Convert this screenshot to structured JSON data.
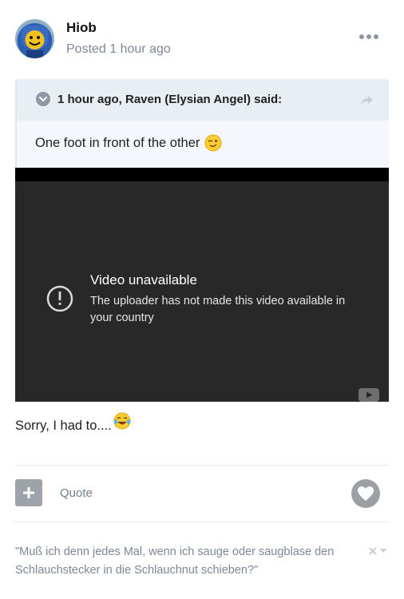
{
  "author": {
    "name": "Hiob",
    "posted": "Posted 1 hour ago",
    "avatar_icon": "lego-spaceman-avatar"
  },
  "quote": {
    "citation": "1 hour ago, Raven (Elysian Angel) said:",
    "text": "One foot in front of the other",
    "emoji": "wink-emoji"
  },
  "video": {
    "title": "Video unavailable",
    "message": "The uploader has not made this video available in your country",
    "alert_icon": "alert-circle-icon",
    "logo_icon": "youtube-icon"
  },
  "post": {
    "text": "Sorry, I had to....",
    "emoji": "tears-of-joy-emoji"
  },
  "actions": {
    "quote_label": "Quote",
    "like_icon": "heart-icon",
    "plus_icon": "plus-icon"
  },
  "signature": {
    "text": "\"Muß ich denn jedes Mal, wenn ich sauge oder saugblase den Schlauchstecker in die Schlauchnut schieben?\""
  },
  "colors": {
    "muted": "#7d8897",
    "quote_bg": "#f4f8fc",
    "quote_header_bg": "#e8eef4",
    "video_bg": "#282828"
  }
}
